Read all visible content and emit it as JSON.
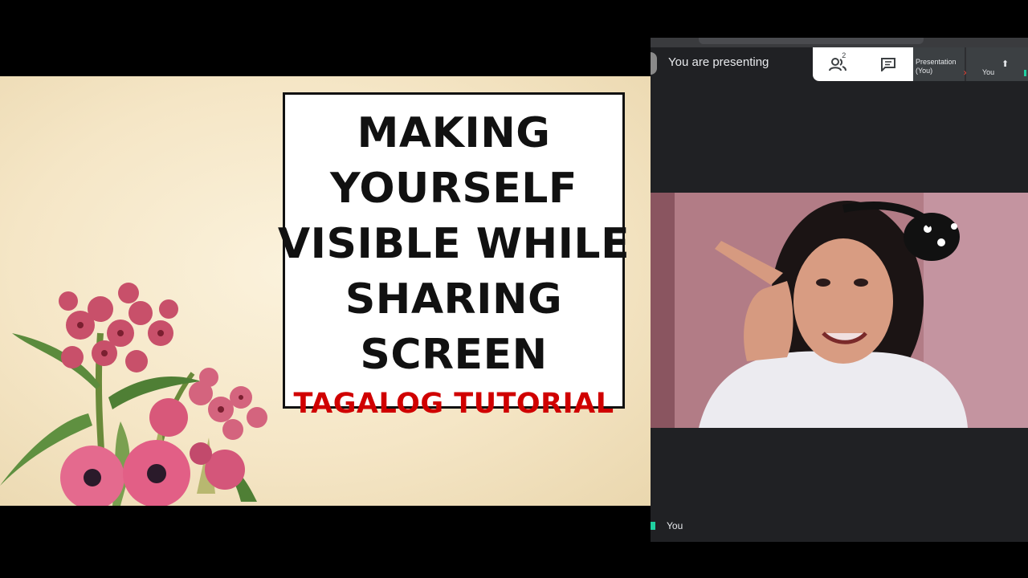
{
  "slide": {
    "title_lines": [
      "MAKING",
      "YOURSELF",
      "VISIBLE WHILE",
      "SHARING",
      "SCREEN"
    ],
    "subtitle": "TAGALOG TUTORIAL",
    "title_color": "#111111",
    "subtitle_color": "#d00000"
  },
  "meet": {
    "presenting_label": "You are presenting",
    "participant_count": "2",
    "tiles": {
      "presentation_label": "Presentation (You)",
      "self_label": "You"
    },
    "self_view_label": "You",
    "colors": {
      "accent_green": "#1fd0a0",
      "panel_bg": "#202124",
      "mute_red": "#ea4335"
    }
  }
}
